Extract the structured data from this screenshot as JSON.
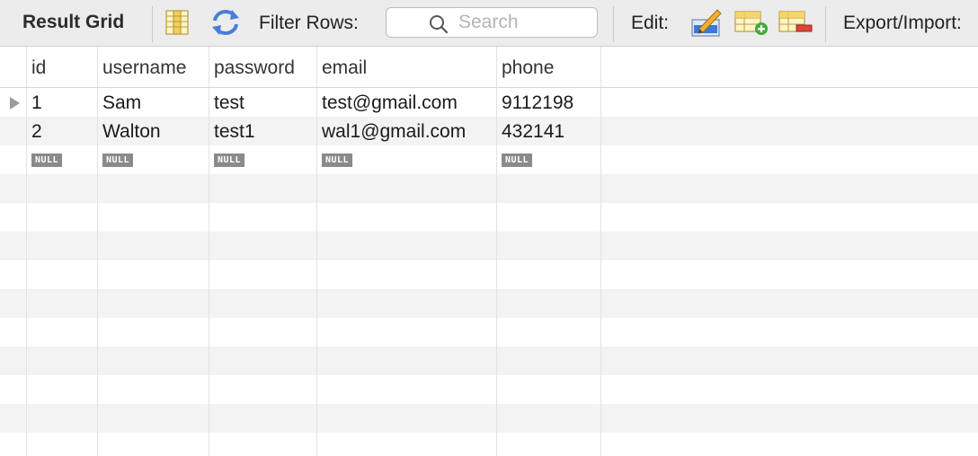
{
  "toolbar": {
    "title": "Result Grid",
    "filter_label": "Filter Rows:",
    "search_placeholder": "Search",
    "search_value": "",
    "edit_label": "Edit:",
    "export_label": "Export/Import:"
  },
  "grid": {
    "columns": [
      "id",
      "username",
      "password",
      "email",
      "phone"
    ],
    "rows": [
      {
        "id": "1",
        "username": "Sam",
        "password": "test",
        "email": "test@gmail.com",
        "phone": "9112198"
      },
      {
        "id": "2",
        "username": "Walton",
        "password": "test1",
        "email": "wal1@gmail.com",
        "phone": "432141"
      }
    ],
    "null_label": "NULL"
  },
  "colors": {
    "toolbar_bg": "#ececec",
    "alt_row_bg": "#f3f3f3",
    "null_badge_bg": "#8a8a8a"
  },
  "icons": [
    "column-toggle-icon",
    "refresh-icon",
    "search-icon",
    "edit-pencil-icon",
    "add-row-icon",
    "delete-row-icon",
    "row-pointer-icon"
  ]
}
